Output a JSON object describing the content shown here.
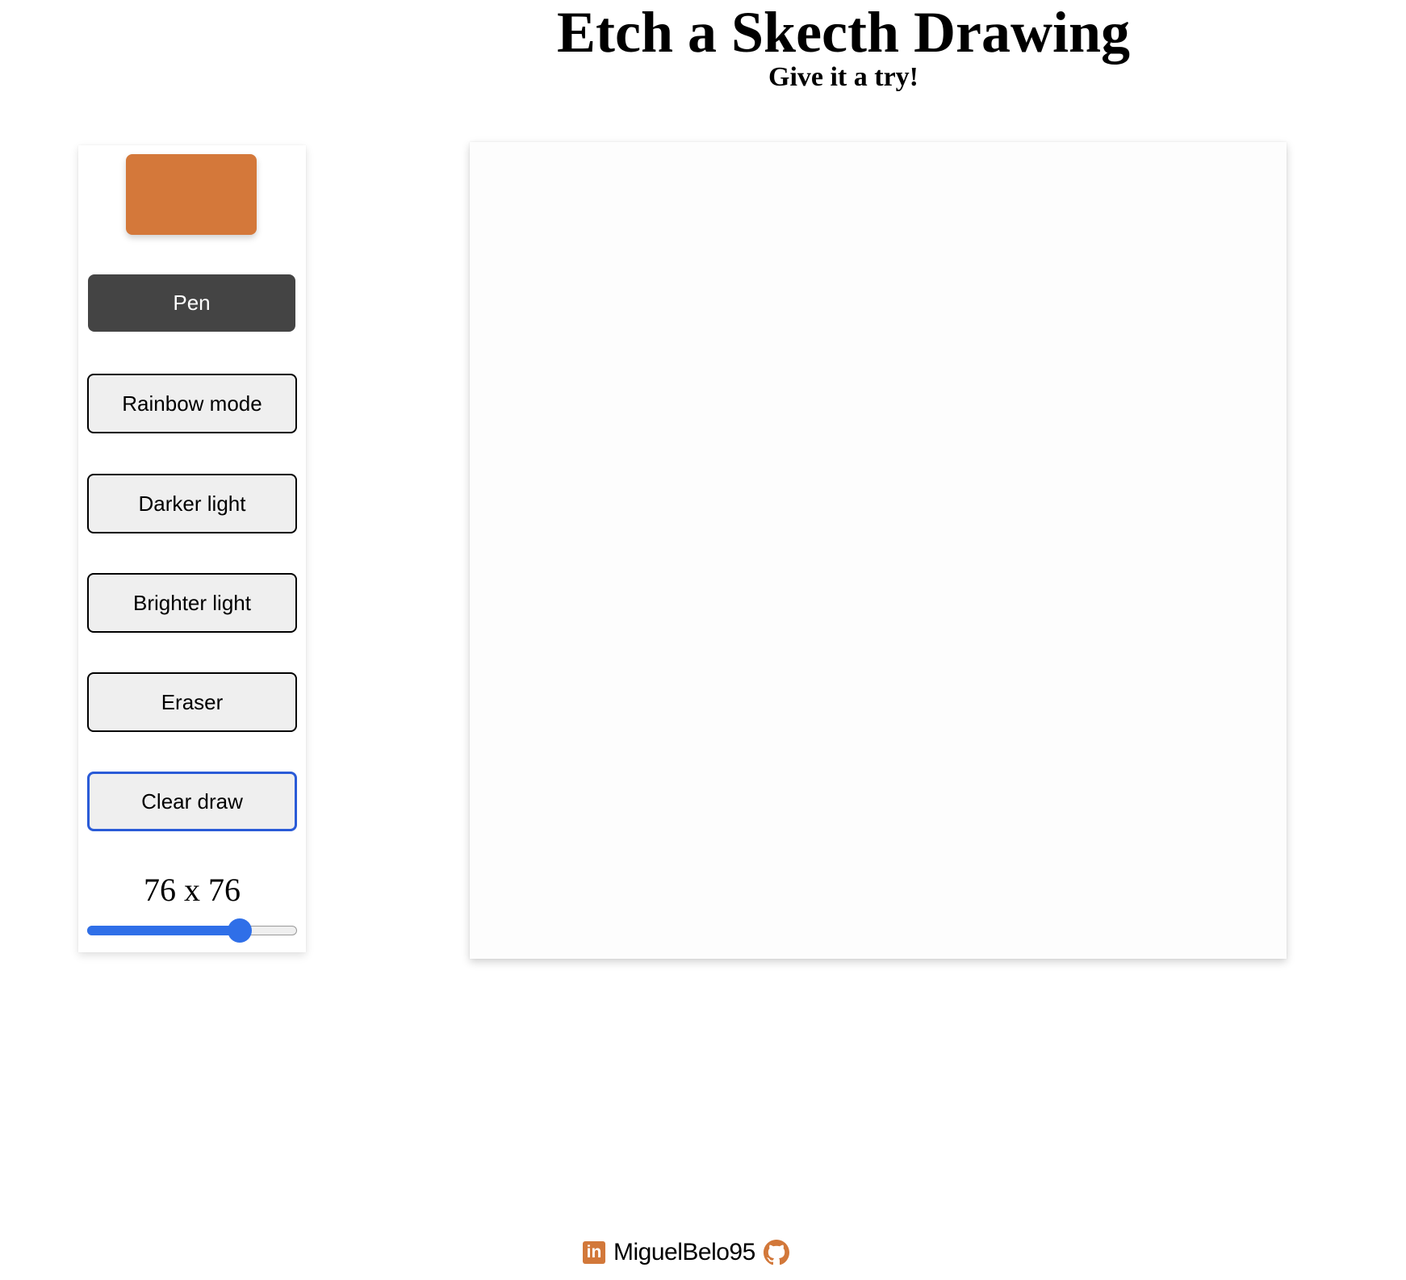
{
  "header": {
    "title": "Etch a Skecth Drawing",
    "subtitle": "Give it a try!"
  },
  "controls": {
    "color_value": "#d4783a",
    "buttons": {
      "pen": "Pen",
      "rainbow": "Rainbow mode",
      "darker": "Darker light",
      "brighter": "Brighter light",
      "eraser": "Eraser",
      "clear": "Clear draw"
    },
    "grid_size_label": "76 x 76",
    "slider": {
      "value": 76,
      "min": 1,
      "max": 100
    }
  },
  "footer": {
    "username": "MiguelBelo95",
    "icons": [
      "linkedin-icon",
      "github-icon"
    ]
  },
  "colors": {
    "accent": "#d4783a",
    "active_button": "#444444",
    "slider": "#2f6fe8",
    "focus_outline": "#2a5bd7"
  }
}
